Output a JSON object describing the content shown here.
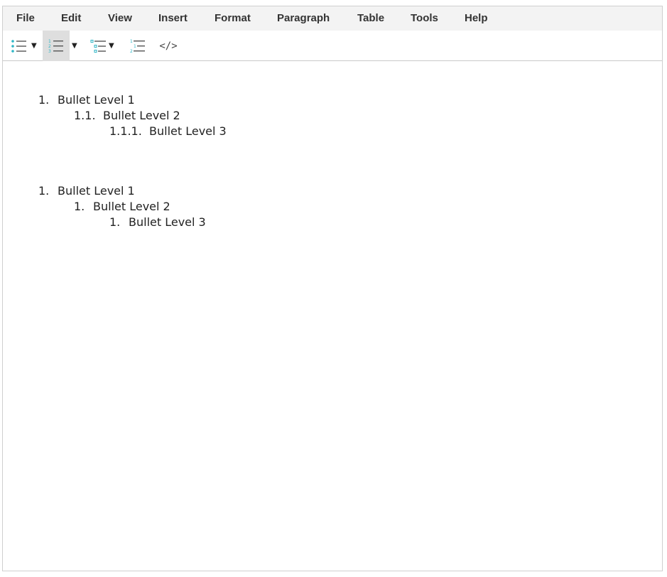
{
  "menubar": {
    "items": [
      "File",
      "Edit",
      "View",
      "Insert",
      "Format",
      "Paragraph",
      "Table",
      "Tools",
      "Help"
    ]
  },
  "toolbar": {
    "buttons": [
      {
        "icon": "bullet-list-icon",
        "has_dropdown": true,
        "active": false
      },
      {
        "icon": "numbered-list-icon",
        "has_dropdown": true,
        "active": true
      },
      {
        "icon": "multilevel-list-icon",
        "has_dropdown": true,
        "active": false
      },
      {
        "icon": "outline-numbered-list-icon",
        "has_dropdown": false,
        "active": false
      },
      {
        "icon": "source-code-icon",
        "has_dropdown": false,
        "active": false
      }
    ],
    "source_code_glyph": "</>",
    "caret_glyph": "▼",
    "accent_color": "#2db5c5"
  },
  "document": {
    "list1": [
      {
        "marker": "1.",
        "text": "Bullet Level 1"
      },
      {
        "marker": "1.1.",
        "text": "Bullet Level 2"
      },
      {
        "marker": "1.1.1.",
        "text": "Bullet Level 3"
      }
    ],
    "list2": [
      {
        "marker": "1.",
        "text": "Bullet Level 1"
      },
      {
        "marker": "1.",
        "text": "Bullet Level 2"
      },
      {
        "marker": "1.",
        "text": "Bullet Level 3"
      }
    ]
  }
}
